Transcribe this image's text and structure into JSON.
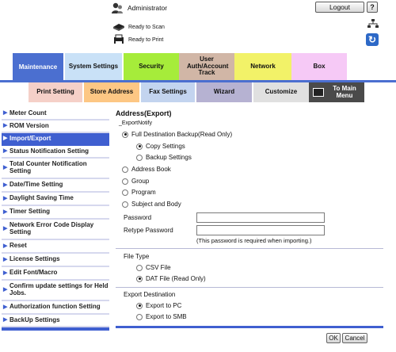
{
  "header": {
    "user": "Administrator",
    "logout_label": "Logout",
    "help_label": "?",
    "status": [
      {
        "icon": "scanner-icon",
        "label": "Ready to Scan"
      },
      {
        "icon": "printer-icon",
        "label": "Ready to Print"
      }
    ]
  },
  "tabs": {
    "main": [
      {
        "label": "Maintenance",
        "color": "#4b6fd0"
      },
      {
        "label": "System Settings",
        "color": "#c9e1f7"
      },
      {
        "label": "Security",
        "color": "#a6ec3a"
      },
      {
        "label": "User Auth/Account Track",
        "color": "#d1b6a6"
      },
      {
        "label": "Network",
        "color": "#f2f268"
      },
      {
        "label": "Box",
        "color": "#f6c9f6"
      }
    ],
    "sub": [
      {
        "label": "Print Setting",
        "color": "#f5d0c8"
      },
      {
        "label": "Store Address",
        "color": "#fdc784"
      },
      {
        "label": "Fax Settings",
        "color": "#c3d4ef"
      },
      {
        "label": "Wizard",
        "color": "#b6b2d2"
      },
      {
        "label": "Customize",
        "color": "#e0e0e0"
      },
      {
        "label": "To Main Menu",
        "color": "#4a4a4a"
      }
    ]
  },
  "sidebar": {
    "active_color": "#3f5fd0",
    "items": [
      {
        "label": "Meter Count",
        "active": false
      },
      {
        "label": "ROM Version",
        "active": false
      },
      {
        "label": "Import/Export",
        "active": true
      },
      {
        "label": "Status Notification Setting",
        "active": false
      },
      {
        "label": "Total Counter Notification Setting",
        "active": false
      },
      {
        "label": "Date/Time Setting",
        "active": false
      },
      {
        "label": "Daylight Saving Time",
        "active": false
      },
      {
        "label": "Timer Setting",
        "active": false
      },
      {
        "label": "Network Error Code Display Setting",
        "active": false
      },
      {
        "label": "Reset",
        "active": false
      },
      {
        "label": "License Settings",
        "active": false
      },
      {
        "label": "Edit Font/Macro",
        "active": false
      },
      {
        "label": "Confirm update settings for Held Jobs.",
        "active": false
      },
      {
        "label": "Authorization function Setting",
        "active": false
      },
      {
        "label": "BackUp Settings",
        "active": false
      }
    ]
  },
  "main": {
    "title": "Address(Export)",
    "export_notify": "_ExportNotify",
    "options": [
      {
        "label": "Full Destination Backup(Read Only)",
        "selected": true
      },
      {
        "label": "Copy Settings",
        "selected": true
      },
      {
        "label": "Backup Settings",
        "selected": false
      },
      {
        "label": "Address Book",
        "selected": false
      },
      {
        "label": "Group",
        "selected": false
      },
      {
        "label": "Program",
        "selected": false
      },
      {
        "label": "Subject and Body",
        "selected": false
      }
    ],
    "password_label": "Password",
    "password_value": "",
    "retype_label": "Retype Password",
    "retype_value": "",
    "password_note": "(This password is required when importing.)",
    "file_type": {
      "title": "File Type",
      "options": [
        {
          "label": "CSV File",
          "selected": false
        },
        {
          "label": "DAT File (Read Only)",
          "selected": true
        }
      ]
    },
    "export_destination": {
      "title": "Export Destination",
      "options": [
        {
          "label": "Export to PC",
          "selected": true
        },
        {
          "label": "Export to SMB",
          "selected": false
        }
      ]
    },
    "ok_label": "OK",
    "cancel_label": "Cancel"
  }
}
